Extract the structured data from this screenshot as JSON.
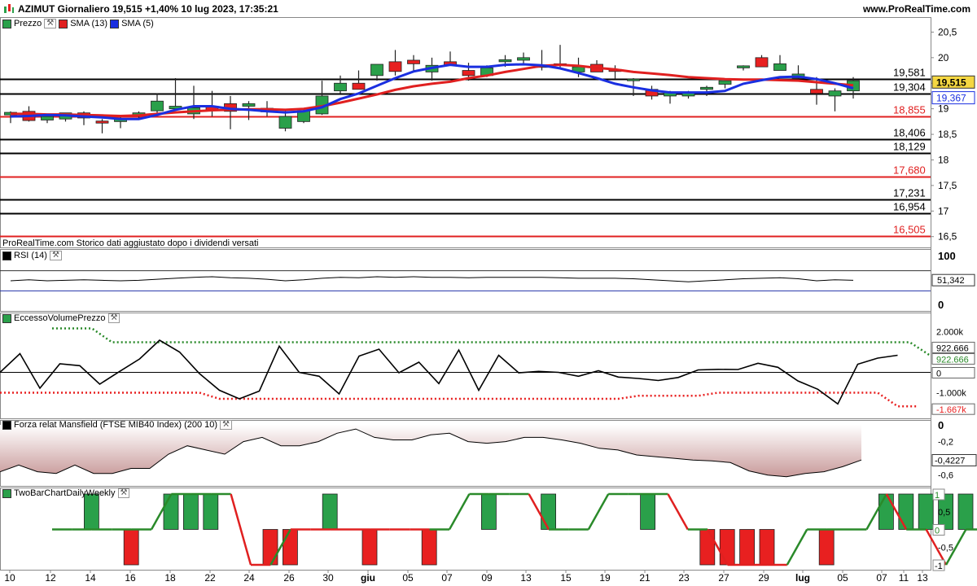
{
  "header": {
    "title": "AZIMUT Giornaliero 19,515 +1,40% 10 lug 2023, 17:35:21",
    "site": "www.ProRealTime.com"
  },
  "footnote": "ProRealTime.com Storico dati aggiustato dopo i dividendi versati",
  "panels": {
    "price": {
      "legend": [
        {
          "label": "Prezzo",
          "color": "#2aa04a"
        },
        {
          "label": "SMA (13)",
          "color": "#e02020"
        },
        {
          "label": "SMA (5)",
          "color": "#1a2fe0"
        }
      ],
      "y_ticks": [
        "20,5",
        "20",
        "19,5",
        "19",
        "18,5",
        "18",
        "17,5",
        "17",
        "16,5"
      ],
      "last_price_tag": "19,515",
      "sma5_tag": "19,367"
    },
    "rsi": {
      "legend": "RSI (14)",
      "y_ticks": [
        "100",
        "0"
      ],
      "value_tag": "51,342"
    },
    "volume": {
      "legend": "EccessoVolumePrezzo",
      "y_ticks": [
        "2.000k",
        "-1.000k"
      ],
      "tags": [
        "922.666",
        "922.666",
        "0",
        "-1.667k"
      ]
    },
    "mansfield": {
      "legend": "Forza relat Mansfield (FTSE MIB40 Index) (200 10)",
      "y_ticks": [
        "0",
        "-0,2",
        "-0,6"
      ],
      "value_tag": "-0,4227"
    },
    "twobar": {
      "legend": "TwoBarChartDailyWeekly",
      "y_ticks": [
        "0,5",
        "-0,5"
      ],
      "tags": [
        "1",
        "0",
        "-1"
      ]
    }
  },
  "x_axis": [
    "10",
    "12",
    "14",
    "16",
    "18",
    "22",
    "24",
    "26",
    "30",
    "giu",
    "05",
    "07",
    "09",
    "13",
    "15",
    "19",
    "21",
    "23",
    "27",
    "29",
    "lug",
    "05",
    "07",
    "11",
    "13"
  ],
  "colors": {
    "up": "#2aa04a",
    "down": "#e82020",
    "sma13": "#e02020",
    "sma5": "#1a2fe0"
  },
  "chart_data": {
    "type": "line",
    "title": "AZIMUT Giornaliero",
    "candles": {
      "open": [
        18.88,
        18.95,
        18.78,
        18.8,
        18.92,
        18.76,
        18.75,
        18.88,
        18.96,
        19.0,
        18.9,
        19.05,
        19.1,
        19.05,
        18.94,
        18.62,
        18.75,
        18.9,
        19.35,
        19.5,
        19.65,
        19.92,
        19.95,
        19.72,
        19.92,
        19.75,
        19.65,
        19.92,
        19.95,
        19.81,
        19.85,
        19.72,
        19.87,
        19.77,
        19.55,
        19.38,
        19.25,
        19.25,
        19.38,
        19.48,
        19.8,
        20.0,
        19.75,
        19.6,
        19.38,
        19.25,
        19.35
      ],
      "high": [
        18.95,
        19.05,
        18.9,
        18.92,
        18.95,
        18.8,
        18.85,
        18.95,
        19.3,
        19.6,
        19.45,
        19.35,
        19.25,
        19.15,
        19.15,
        19.0,
        19.0,
        19.55,
        19.65,
        19.75,
        19.85,
        20.15,
        20.05,
        20.0,
        20.12,
        19.9,
        19.85,
        20.05,
        20.1,
        20.15,
        20.25,
        20.0,
        19.95,
        19.85,
        19.6,
        19.45,
        19.35,
        19.35,
        19.45,
        19.55,
        19.85,
        20.05,
        20.05,
        19.85,
        19.62,
        19.4,
        19.62
      ],
      "low": [
        18.72,
        18.75,
        18.72,
        18.75,
        18.68,
        18.52,
        18.62,
        18.8,
        18.92,
        19.05,
        18.8,
        18.85,
        18.6,
        18.78,
        18.85,
        18.56,
        18.72,
        18.88,
        19.3,
        19.4,
        19.55,
        19.65,
        19.75,
        19.55,
        19.85,
        19.55,
        19.62,
        19.82,
        19.85,
        19.75,
        19.8,
        19.62,
        19.75,
        19.58,
        19.25,
        19.18,
        19.1,
        19.2,
        19.25,
        19.4,
        19.75,
        19.82,
        19.75,
        19.58,
        19.08,
        18.95,
        19.2
      ],
      "close": [
        18.93,
        18.77,
        18.85,
        18.92,
        18.82,
        18.72,
        18.8,
        18.92,
        19.15,
        19.05,
        19.02,
        18.97,
        18.95,
        19.1,
        19.01,
        18.85,
        18.96,
        19.25,
        19.5,
        19.38,
        19.87,
        19.73,
        19.88,
        19.85,
        19.85,
        19.65,
        19.8,
        19.96,
        20.0,
        19.86,
        19.88,
        19.82,
        19.72,
        19.73,
        19.58,
        19.25,
        19.32,
        19.32,
        19.42,
        19.55,
        19.84,
        19.82,
        19.88,
        19.68,
        19.3,
        19.35,
        19.55
      ]
    },
    "sma13": [
      18.9,
      18.9,
      18.89,
      18.89,
      18.88,
      18.87,
      18.86,
      18.87,
      18.9,
      18.93,
      18.95,
      18.97,
      18.98,
      18.99,
      18.99,
      18.98,
      19.0,
      19.05,
      19.12,
      19.2,
      19.28,
      19.37,
      19.44,
      19.49,
      19.53,
      19.6,
      19.65,
      19.72,
      19.78,
      19.84,
      19.86,
      19.84,
      19.8,
      19.77,
      19.72,
      19.69,
      19.66,
      19.62,
      19.6,
      19.58,
      19.57,
      19.57,
      19.56,
      19.55,
      19.52,
      19.49,
      19.46
    ],
    "sma5": [
      18.85,
      18.86,
      18.88,
      18.87,
      18.85,
      18.83,
      18.8,
      18.8,
      18.88,
      18.98,
      19.05,
      19.05,
      19.0,
      18.98,
      18.95,
      18.93,
      18.95,
      19.03,
      19.19,
      19.3,
      19.45,
      19.6,
      19.73,
      19.8,
      19.86,
      19.82,
      19.82,
      19.86,
      19.87,
      19.85,
      19.79,
      19.7,
      19.6,
      19.49,
      19.42,
      19.36,
      19.32,
      19.32,
      19.32,
      19.35,
      19.49,
      19.56,
      19.62,
      19.63,
      19.58,
      19.5,
      19.4
    ],
    "horizontal_levels": [
      {
        "value": 19.581,
        "label": "19,581",
        "color": "#000000"
      },
      {
        "value": 19.304,
        "label": "19,304",
        "color": "#000000"
      },
      {
        "value": 18.855,
        "label": "18,855",
        "color": "#e02020"
      },
      {
        "value": 18.406,
        "label": "18,406",
        "color": "#000000"
      },
      {
        "value": 18.129,
        "label": "18,129",
        "color": "#000000"
      },
      {
        "value": 17.68,
        "label": "17,680",
        "color": "#e02020"
      },
      {
        "value": 17.231,
        "label": "17,231",
        "color": "#000000"
      },
      {
        "value": 16.954,
        "label": "16,954",
        "color": "#000000"
      },
      {
        "value": 16.505,
        "label": "16,505",
        "color": "#e02020"
      }
    ],
    "ylim": [
      16.4,
      20.65
    ],
    "rsi": [
      50,
      52,
      50,
      51,
      52,
      51,
      50,
      51,
      53,
      55,
      57,
      58,
      56,
      55,
      53,
      50,
      52,
      55,
      57,
      56,
      58,
      57,
      58,
      57,
      57,
      56,
      57,
      57,
      57,
      57,
      56,
      55,
      55,
      55,
      54,
      52,
      50,
      48,
      50,
      52,
      54,
      55,
      56,
      54,
      50,
      52,
      51
    ],
    "volume_excess": [
      0,
      920,
      -780,
      420,
      330,
      -580,
      50,
      660,
      1580,
      1000,
      -60,
      -880,
      -1300,
      -920,
      1290,
      0,
      -190,
      -1060,
      800,
      1140,
      -20,
      500,
      -550,
      1100,
      -880,
      840,
      -20,
      50,
      0,
      -190,
      80,
      -230,
      -300,
      -400,
      -250,
      120,
      150,
      140,
      450,
      250,
      -420,
      -830,
      -1550,
      400,
      700,
      840
    ],
    "volume_upper": [
      2160,
      2160,
      2160,
      2160,
      2160,
      1480,
      1480,
      1480,
      1480,
      1480,
      1480,
      1480,
      1480,
      1480,
      1480,
      1480,
      1480,
      1480,
      1480,
      1480,
      1480,
      1480,
      1480,
      1480,
      1480,
      1480,
      1480,
      1480,
      1480,
      1480,
      1480,
      1480,
      1480,
      1480,
      1480,
      1480,
      1480,
      1480,
      1480,
      1480,
      1480,
      1480,
      1480,
      1480,
      1480,
      1480,
      840
    ],
    "volume_lower": [
      -1000,
      -1000,
      -1000,
      -1000,
      -1000,
      -1000,
      -1000,
      -1000,
      -1000,
      -1000,
      -1000,
      -1300,
      -1300,
      -1300,
      -1300,
      -1300,
      -1300,
      -1300,
      -1300,
      -1300,
      -1300,
      -1300,
      -1300,
      -1300,
      -1300,
      -1300,
      -1300,
      -1300,
      -1300,
      -1300,
      -1300,
      -1300,
      -1150,
      -1150,
      -1150,
      -1150,
      -1000,
      -1000,
      -1000,
      -1000,
      -1000,
      -1000,
      -1000,
      -1000,
      -1000,
      -1667,
      -1667
    ],
    "mansfield": [
      -0.56,
      -0.48,
      -0.56,
      -0.58,
      -0.48,
      -0.58,
      -0.58,
      -0.52,
      -0.52,
      -0.35,
      -0.25,
      -0.3,
      -0.35,
      -0.2,
      -0.15,
      -0.25,
      -0.25,
      -0.2,
      -0.1,
      -0.05,
      -0.15,
      -0.18,
      -0.18,
      -0.12,
      -0.1,
      -0.2,
      -0.22,
      -0.2,
      -0.15,
      -0.15,
      -0.18,
      -0.22,
      -0.28,
      -0.3,
      -0.36,
      -0.38,
      -0.4,
      -0.42,
      -0.43,
      -0.45,
      -0.55,
      -0.6,
      -0.62,
      -0.58,
      -0.56,
      -0.5,
      -0.42
    ],
    "twobar_bars": [
      0,
      1,
      0,
      -1,
      0,
      1,
      1,
      1,
      0,
      0,
      -1,
      -1,
      0,
      1,
      0,
      -1,
      0,
      0,
      -1,
      0,
      0,
      1,
      0,
      0,
      1,
      0,
      0,
      0,
      0,
      1,
      0,
      0,
      -1,
      -1,
      -1,
      -1,
      0,
      0,
      -1,
      0,
      0,
      1,
      1,
      1,
      1,
      1,
      0,
      -1,
      -1,
      0,
      1
    ],
    "twobar_line": [
      0,
      0,
      0,
      0,
      0,
      0,
      1,
      1,
      1,
      1,
      -1,
      -1,
      0,
      0,
      0,
      0,
      0,
      0,
      0,
      0,
      0,
      1,
      1,
      1,
      1,
      0,
      0,
      0,
      1,
      1,
      1,
      1,
      0,
      0,
      -1,
      -1,
      -1,
      -1,
      0,
      0,
      0,
      0,
      1,
      0,
      0,
      -1,
      0,
      0
    ],
    "x_tick_labels": [
      "10",
      "12",
      "14",
      "16",
      "18",
      "22",
      "24",
      "26",
      "30",
      "giu",
      "05",
      "07",
      "09",
      "13",
      "15",
      "19",
      "21",
      "23",
      "27",
      "29",
      "lug",
      "05",
      "07",
      "11",
      "13"
    ]
  }
}
